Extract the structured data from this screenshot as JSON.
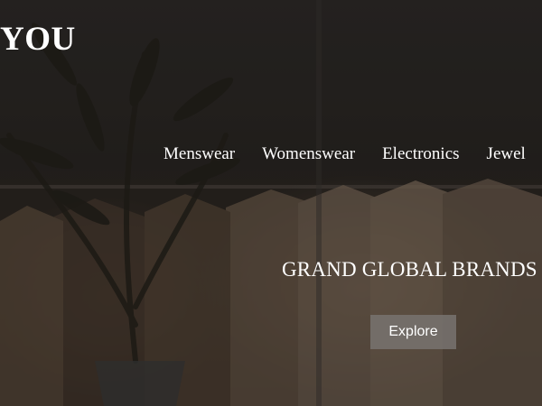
{
  "brand": {
    "logo_text": "YOU"
  },
  "nav": {
    "items": [
      {
        "label": "Menswear"
      },
      {
        "label": "Womenswear"
      },
      {
        "label": "Electronics"
      },
      {
        "label": "Jewel"
      }
    ]
  },
  "hero": {
    "headline": "GRAND GLOBAL BRANDS",
    "cta_label": "Explore"
  },
  "colors": {
    "text": "#ffffff",
    "button_bg": "#78736f",
    "overlay": "#000000"
  }
}
